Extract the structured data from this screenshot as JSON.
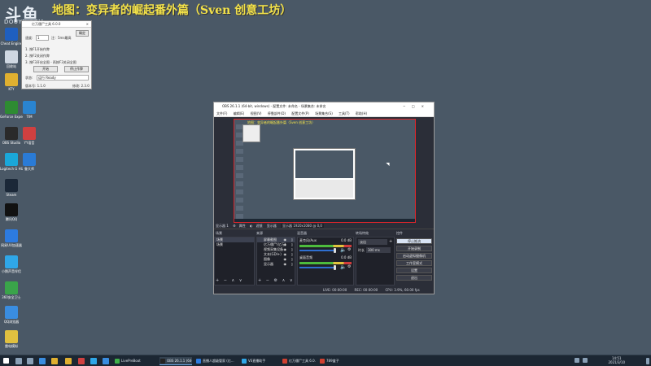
{
  "overlay": {
    "logo_big": "斗鱼",
    "logo_small": "DOUYU.COM",
    "title": "地图：变异者的崛起番外篇（Sven 创意工坊）"
  },
  "desktop_icons": [
    {
      "label": "Cheat Engine",
      "color": "#1f5fbf"
    },
    {
      "label": "回收站",
      "color": "#cfd8e2"
    },
    {
      "label": "KTY",
      "color": "#e0b030"
    },
    {
      "label": "GeForce Experience",
      "color": "#2e8b32"
    },
    {
      "label": "OBS Studio",
      "color": "#2a2a2a"
    },
    {
      "label": "Logitech G HUB",
      "color": "#1aa7d9"
    },
    {
      "label": "Steam",
      "color": "#1b2838"
    },
    {
      "label": "腾讯QQ",
      "color": "#111111"
    },
    {
      "label": "网易UU加速器",
      "color": "#2d7be0"
    },
    {
      "label": "小鹅声音伴侣",
      "color": "#2fa7e8"
    },
    {
      "label": "360安全卫士",
      "color": "#3aa44a"
    },
    {
      "label": "QQ浏览器",
      "color": "#3a8de0"
    },
    {
      "label": "雷电模拟",
      "color": "#e0c040"
    },
    {
      "label": "TIM",
      "color": "#2a84d0"
    },
    {
      "label": "YY语音",
      "color": "#d04040"
    },
    {
      "label": "鲁大师",
      "color": "#2a7bd6"
    }
  ],
  "tool_window": {
    "title": "亿万僵尸工具 6.0.0",
    "minimize": "—",
    "close": "×",
    "speed_label": "速度:",
    "speed_value": "1",
    "speed_hint": "注：5ms最高",
    "confirm_button": "确定",
    "line1": "1. 按F1开始作弊",
    "line2": "2. 按F2关闭作弊",
    "line3": "3. 按F3开启全图 - 再按F3关闭全图",
    "start_button": "开始",
    "stop_button": "停止作弊",
    "status_label": "状态:",
    "status_value": "运行  Ready",
    "version": "版本号: 1.1.0",
    "build": "修改: 2.3.0"
  },
  "obs": {
    "title": "OBS 26.1.1 (64-bit, windows) - 配置文件: 未命名 - 场景集合: 未命名",
    "menu": [
      "文件(F)",
      "编辑(E)",
      "视图(V)",
      "停靠部件(D)",
      "配置文件(P)",
      "场景集合(S)",
      "工具(T)",
      "帮助(H)"
    ],
    "preview_title": "地图：变异者的崛起番外篇（Sven 创意工坊）",
    "toolbar": [
      "显示器 1",
      "属性",
      "滤镜",
      "显示器",
      "显示器 1920x1080 @ 0,0"
    ],
    "scenes_label": "场景",
    "scenes": [
      "场景",
      "场景"
    ],
    "sources_label": "来源",
    "sources": [
      "屏幕截图",
      "亿万僵尸(亿万)",
      "视频采集设备",
      "文本(GDI+)",
      "图像",
      "显示器"
    ],
    "mixer_label": "混音器",
    "mixer": [
      {
        "name": "麦克风/Aux",
        "db": "0.0 dB"
      },
      {
        "name": "桌面音频",
        "db": "0.0 dB"
      }
    ],
    "transitions_label": "转场特效",
    "transition_value": "淡出",
    "duration_label": "时长",
    "duration_value": "300 ms",
    "controls_label": "控件",
    "controls": [
      "停止推流",
      "开始录制",
      "启动虚拟摄像机",
      "工作室模式",
      "设置",
      "退出"
    ],
    "status": [
      "LIVE: 00:00:00",
      "REC: 00:00:00",
      "CPU: 3.9%, 60.00 fps"
    ]
  },
  "taskbar": {
    "items": [
      {
        "label": "LivePreBoot",
        "color": "#3fb04a"
      },
      {
        "label": "OBS 26.1.1 (64-bit)...",
        "color": "#222222"
      },
      {
        "label": "直播人超级管家 (亿...",
        "color": "#2d7be0"
      },
      {
        "label": "VS直播助手",
        "color": "#2fa7e8"
      },
      {
        "label": "亿万僵尸工具 6.0.0",
        "color": "#d04030"
      },
      {
        "label": "789盒子",
        "color": "#d04030"
      }
    ],
    "time": "14:51",
    "date": "2021/3/10"
  }
}
